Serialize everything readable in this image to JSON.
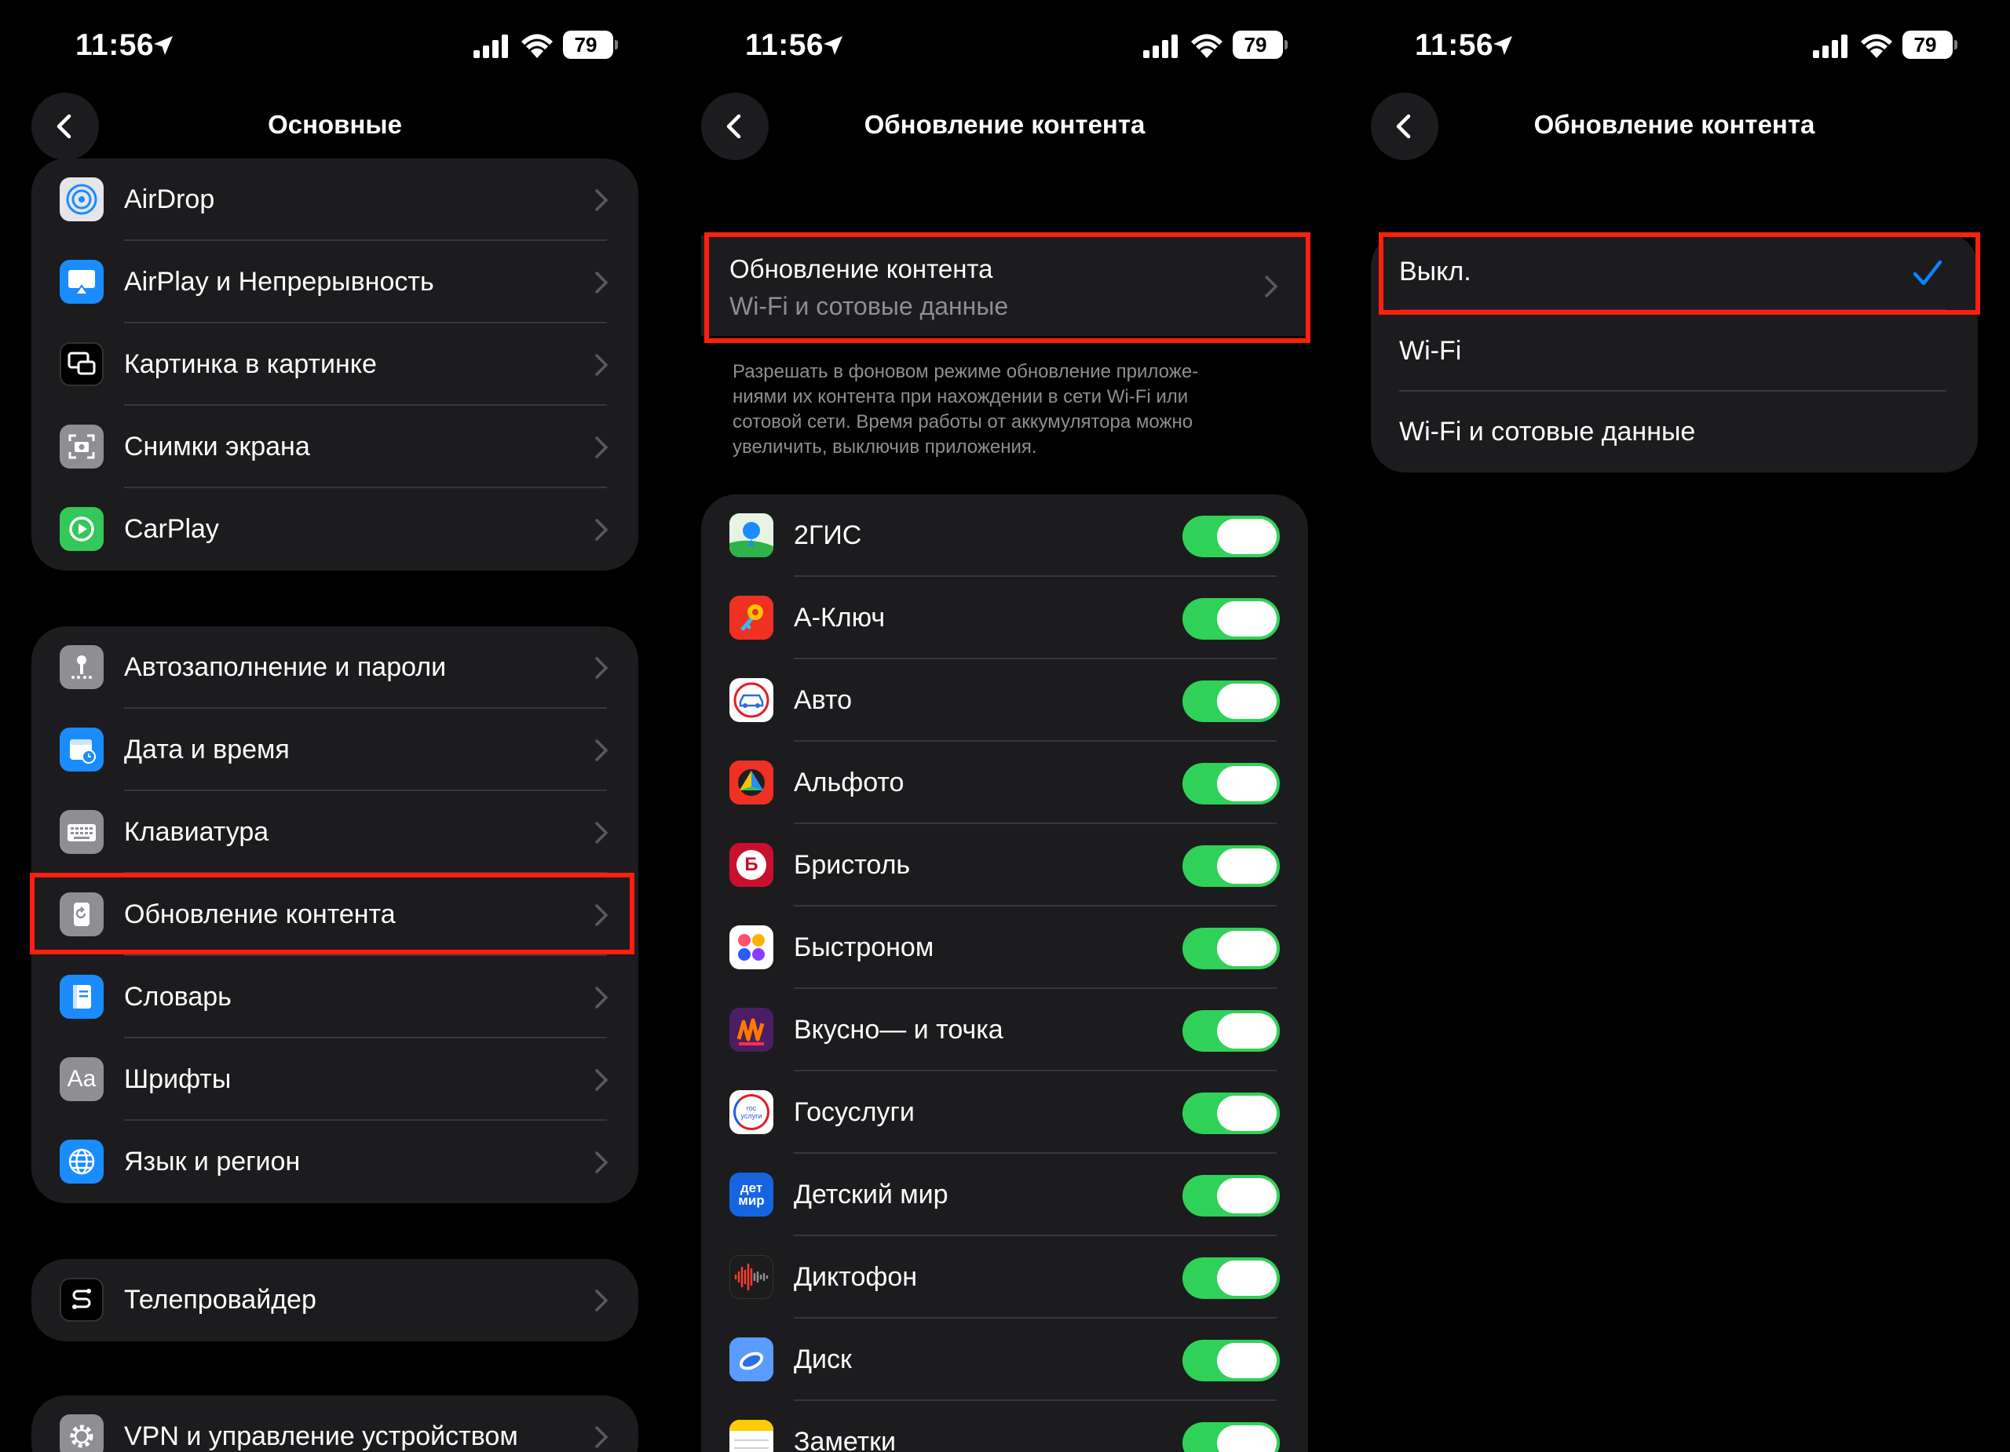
{
  "status": {
    "time": "11:56",
    "battery": "79"
  },
  "screen1": {
    "title": "Основные",
    "group1": [
      {
        "label": "AirDrop",
        "icon": "airdrop-icon"
      },
      {
        "label": "AirPlay и Непрерывность",
        "icon": "airplay-icon"
      },
      {
        "label": "Картинка в картинке",
        "icon": "pip-icon"
      },
      {
        "label": "Снимки экрана",
        "icon": "screenshot-icon"
      },
      {
        "label": "CarPlay",
        "icon": "carplay-icon"
      }
    ],
    "group2": [
      {
        "label": "Автозаполнение и пароли",
        "icon": "key-icon"
      },
      {
        "label": "Дата и время",
        "icon": "calendar-clock-icon"
      },
      {
        "label": "Клавиатура",
        "icon": "keyboard-icon"
      },
      {
        "label": "Обновление контента",
        "icon": "refresh-icon"
      },
      {
        "label": "Словарь",
        "icon": "dictionary-icon"
      },
      {
        "label": "Шрифты",
        "icon": "fonts-icon",
        "glyph": "Aa"
      },
      {
        "label": "Язык и регион",
        "icon": "globe-icon"
      }
    ],
    "group3": [
      {
        "label": "Телепровайдер",
        "icon": "tv-provider-icon"
      }
    ],
    "group4": [
      {
        "label": "VPN и управление устройством",
        "icon": "gear-icon"
      }
    ]
  },
  "screen2": {
    "title": "Обновление контента",
    "setting": {
      "label": "Обновление контента",
      "value": "Wi-Fi и сотовые данные"
    },
    "footnote": "Разрешать в фоновом режиме обновление приложе-\nниями их контента при нахождении в сети Wi-Fi или\nсотовой сети. Время работы от аккумулятора можно\nувеличить, выключив приложения.",
    "apps": [
      {
        "label": "2ГИС",
        "icon": "2gis-icon",
        "on": true
      },
      {
        "label": "А-Ключ",
        "icon": "a-key-icon",
        "on": true
      },
      {
        "label": "Авто",
        "icon": "auto-icon",
        "on": true
      },
      {
        "label": "Альфото",
        "icon": "alfoto-icon",
        "on": true
      },
      {
        "label": "Бристоль",
        "icon": "bristol-icon",
        "glyph": "Б",
        "on": true
      },
      {
        "label": "Быстроном",
        "icon": "bystronom-icon",
        "on": true
      },
      {
        "label": "Вкусно— и точка",
        "icon": "vkusno-icon",
        "on": true
      },
      {
        "label": "Госуслуги",
        "icon": "gosuslugi-icon",
        "glyph": "гос\nуслуги",
        "on": true
      },
      {
        "label": "Детский мир",
        "icon": "detsky-mir-icon",
        "glyph": "дет\nмир",
        "on": true
      },
      {
        "label": "Диктофон",
        "icon": "voice-memos-icon",
        "on": true
      },
      {
        "label": "Диск",
        "icon": "disk-icon",
        "on": true
      },
      {
        "label": "Заметки",
        "icon": "notes-icon",
        "on": true
      }
    ]
  },
  "screen3": {
    "title": "Обновление контента",
    "options": [
      {
        "label": "Выкл.",
        "selected": true
      },
      {
        "label": "Wi-Fi",
        "selected": false
      },
      {
        "label": "Wi-Fi и сотовые данные",
        "selected": false
      }
    ]
  },
  "colors": {
    "toggle_on": "#30d158",
    "highlight": "#ff1f0f",
    "check": "#0a84ff",
    "cell": "#1c1c1e"
  }
}
